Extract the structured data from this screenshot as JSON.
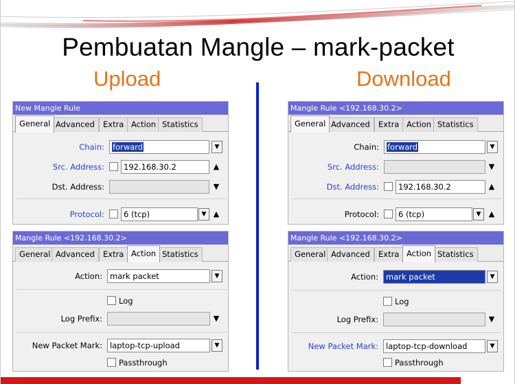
{
  "slide": {
    "title": "Pembuatan Mangle – mark-packet",
    "upload_label": "Upload",
    "download_label": "Download"
  },
  "colors": {
    "title_accent": "#e8731a",
    "divider": "#0a1fd4",
    "window_titlebar": "#6a6ad6",
    "bottom_bar": "#d01818"
  },
  "windows": {
    "ul_general": {
      "title": "New Mangle Rule",
      "tabs": [
        "General",
        "Advanced",
        "Extra",
        "Action",
        "Statistics"
      ],
      "chain_label": "Chain:",
      "chain_value": "forward",
      "src_label": "Src. Address:",
      "src_value": "192.168.30.2",
      "dst_label": "Dst. Address:",
      "dst_value": "",
      "proto_label": "Protocol:",
      "proto_value": "6 (tcp)"
    },
    "ul_action": {
      "title": "Mangle Rule <192.168.30.2>",
      "tabs": [
        "General",
        "Advanced",
        "Extra",
        "Action",
        "Statistics"
      ],
      "action_label": "Action:",
      "action_value": "mark packet",
      "log_label": "Log",
      "log_prefix_label": "Log Prefix:",
      "log_prefix_value": "",
      "mark_label": "New Packet Mark:",
      "mark_value": "laptop-tcp-upload",
      "passthrough_label": "Passthrough"
    },
    "dl_general": {
      "title": "Mangle Rule <192.168.30.2>",
      "tabs": [
        "General",
        "Advanced",
        "Extra",
        "Action",
        "Statistics"
      ],
      "chain_label": "Chain:",
      "chain_value": "forward",
      "src_label": "Src. Address:",
      "src_value": "",
      "dst_label": "Dst. Address:",
      "dst_value": "192.168.30.2",
      "proto_label": "Protocol:",
      "proto_value": "6 (tcp)"
    },
    "dl_action": {
      "title": "Mangle Rule <192.168.30.2>",
      "tabs": [
        "General",
        "Advanced",
        "Extra",
        "Action",
        "Statistics"
      ],
      "action_label": "Action:",
      "action_value": "mark packet",
      "log_label": "Log",
      "log_prefix_label": "Log Prefix:",
      "log_prefix_value": "",
      "mark_label": "New Packet Mark:",
      "mark_value": "laptop-tcp-download",
      "passthrough_label": "Passthrough"
    }
  }
}
